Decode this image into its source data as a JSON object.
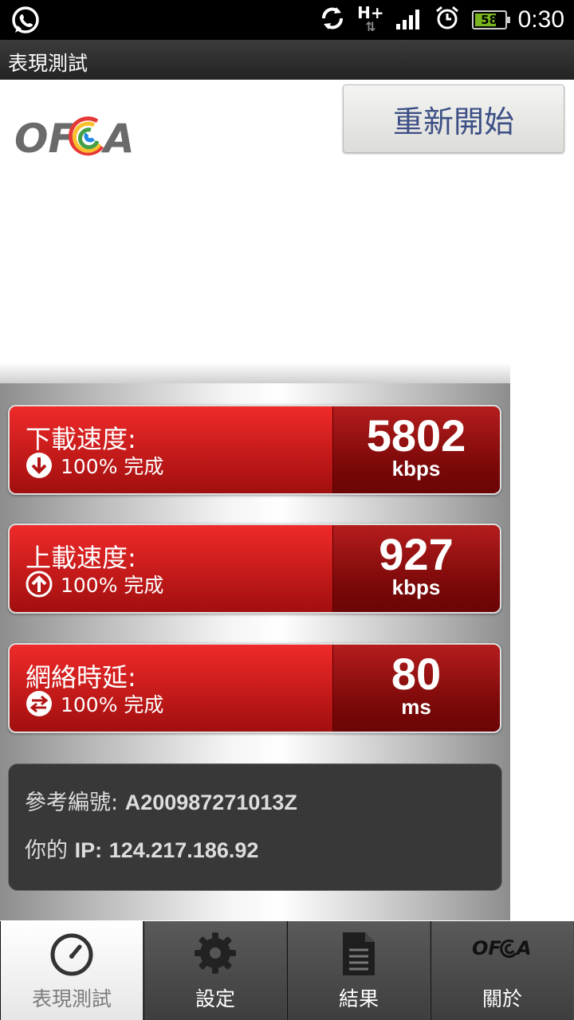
{
  "status_bar": {
    "time": "0:30",
    "battery_level": "58",
    "network_type": "H+",
    "icons": [
      "whatsapp-icon",
      "sync-icon",
      "network-h-plus-icon",
      "signal-icon",
      "alarm-icon",
      "battery-icon"
    ]
  },
  "title_bar": {
    "title": "表現測試"
  },
  "header": {
    "logo_text": "OFCA",
    "restart_label": "重新開始"
  },
  "metrics": [
    {
      "label": "下載速度:",
      "progress": "100% 完成",
      "value": "5802",
      "unit": "kbps",
      "icon": "download-arrow-icon"
    },
    {
      "label": "上載速度:",
      "progress": "100% 完成",
      "value": "927",
      "unit": "kbps",
      "icon": "upload-arrow-icon"
    },
    {
      "label": "網絡時延:",
      "progress": "100% 完成",
      "value": "80",
      "unit": "ms",
      "icon": "latency-swap-icon"
    }
  ],
  "info": {
    "reference_label": "參考編號:",
    "reference_value": "A200987271013Z",
    "ip_label_prefix": "你的",
    "ip_label": "IP:",
    "ip_value": "124.217.186.92"
  },
  "tabs": [
    {
      "label": "表現測試",
      "icon": "speedometer-icon",
      "active": true
    },
    {
      "label": "設定",
      "icon": "gear-icon",
      "active": false
    },
    {
      "label": "結果",
      "icon": "document-list-icon",
      "active": false
    },
    {
      "label": "關於",
      "icon": "ofca-logo-icon",
      "active": false
    }
  ],
  "colors": {
    "metric_red": "#d81f1f",
    "metric_dark_red": "#7a0808",
    "button_text": "#3c4f85"
  }
}
